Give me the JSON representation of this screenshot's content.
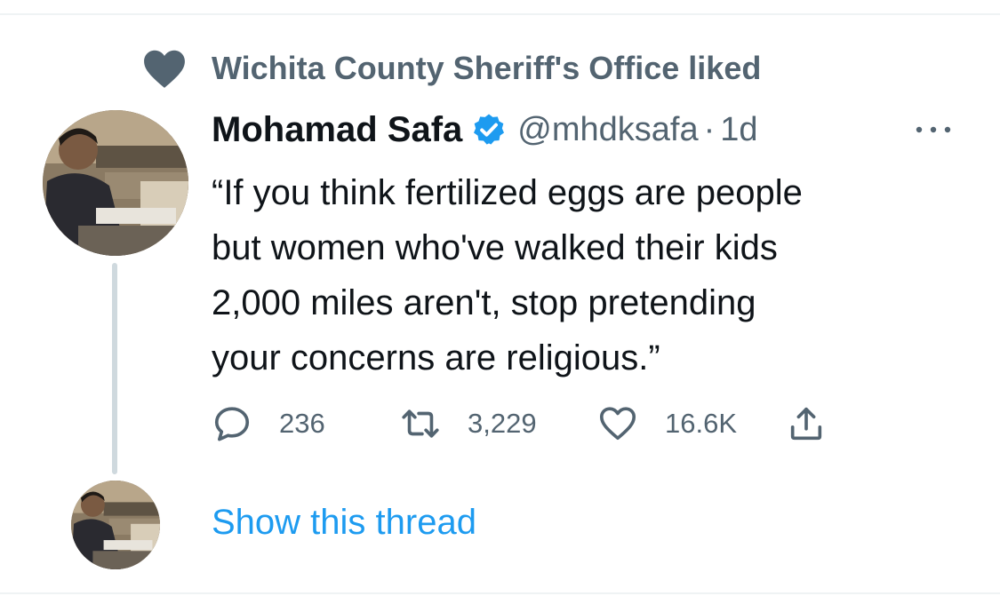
{
  "social_context": {
    "text": "Wichita County Sheriff's Office liked",
    "icon": "heart-icon"
  },
  "tweet": {
    "display_name": "Mohamad Safa",
    "verified_icon": "verified-badge-icon",
    "handle": "@mhdksafa",
    "separator": "·",
    "time": "1d",
    "more_icon": "more-options-icon",
    "text_lines": [
      "“If you think fertilized eggs are people",
      "but women who've walked their kids",
      "2,000 miles aren't, stop pretending",
      "your concerns are religious.”"
    ],
    "actions": {
      "reply": {
        "icon": "reply-icon",
        "count": "236"
      },
      "retweet": {
        "icon": "retweet-icon",
        "count": "3,229"
      },
      "like": {
        "icon": "like-icon",
        "count": "16.6K"
      },
      "share": {
        "icon": "share-icon"
      }
    }
  },
  "thread": {
    "link_text": "Show this thread"
  },
  "colors": {
    "text_primary": "#0f1419",
    "text_secondary": "#536471",
    "link": "#1d9bf0",
    "verified": "#1d9bf0",
    "divider": "#eff3f4",
    "thread_line": "#cfd9de"
  }
}
